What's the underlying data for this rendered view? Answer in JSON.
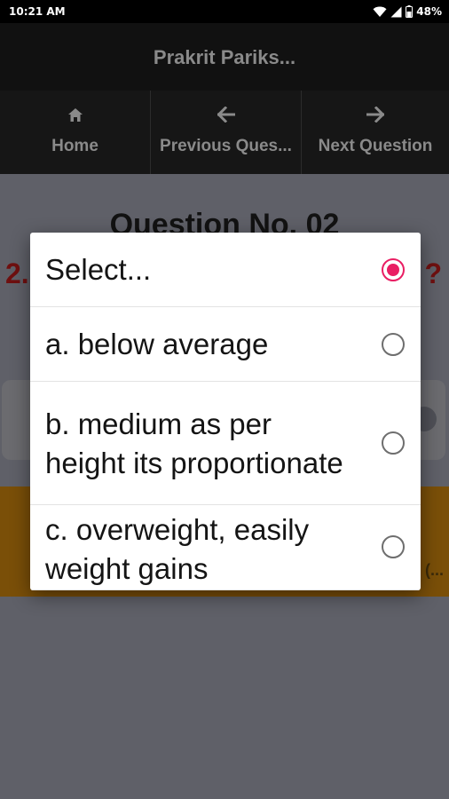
{
  "status_bar": {
    "time": "10:21 AM",
    "battery": "48%",
    "icons": [
      "wifi-icon",
      "signal-icon",
      "battery-icon"
    ]
  },
  "app_bar": {
    "title": "Prakrit Pariks..."
  },
  "nav": [
    {
      "label": "Home",
      "icon": "home-icon"
    },
    {
      "label": "Previous Ques...",
      "icon": "arrow-left-icon"
    },
    {
      "label": "Next Question",
      "icon": "arrow-right-icon"
    }
  ],
  "background": {
    "heading": "Question No. 02",
    "question_number": "2.",
    "question_mark": "?",
    "ellipsis": "(..."
  },
  "dialog": {
    "options": [
      {
        "label": "Select...",
        "selected": true
      },
      {
        "label": "a. below average",
        "selected": false
      },
      {
        "label": "b. medium as per height its proportionate",
        "selected": false
      },
      {
        "label": "c. overweight, easily weight gains",
        "selected": false
      }
    ]
  },
  "colors": {
    "accent": "#e91e63",
    "overlay_background": "#5f6068",
    "dialog_background": "#ffffff"
  }
}
